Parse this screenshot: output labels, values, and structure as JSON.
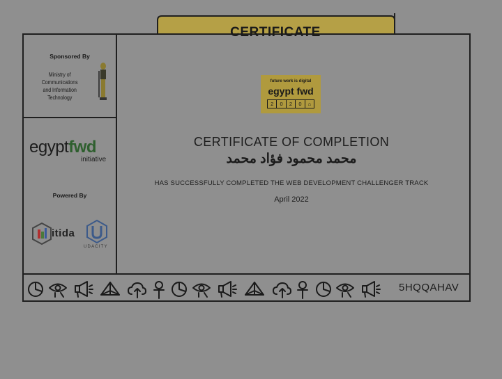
{
  "ribbon": {
    "title": "CERTIFICATE"
  },
  "sidebar": {
    "sponsored_label": "Sponsored By",
    "ministry_line1": "Ministry of Communications",
    "ministry_line2": "and Information Technology",
    "egypt_text": "egypt",
    "fwd_text": "fwd",
    "initiative_text": "initiative",
    "powered_label": "Powered By",
    "itida_text": "itida",
    "udacity_text": "UDACITY"
  },
  "badge": {
    "tagline": "future work is digital",
    "name": "egypt fwd",
    "year_digits": [
      "2",
      "0",
      "2",
      "0"
    ]
  },
  "main": {
    "heading": "CERTIFICATE OF COMPLETION",
    "recipient": "محمد محمود فؤاد محمد",
    "completed_text": "HAS SUCCESSFULLY COMPLETED THE WEB DEVELOPMENT CHALLENGER TRACK",
    "date": "April 2022"
  },
  "footer": {
    "certificate_code": "5HQQAHAV",
    "symbol_icons": [
      "pie-icon",
      "eye-icon",
      "megaphone-icon",
      "pyramid-icon",
      "cloud-upload-icon",
      "ankh-icon",
      "pie-icon",
      "eye-icon",
      "megaphone-icon",
      "pyramid-icon",
      "cloud-upload-icon",
      "ankh-icon",
      "pie-icon",
      "eye-icon",
      "megaphone-icon"
    ]
  },
  "colors": {
    "background": "#8f8f8f",
    "ribbon_gold": "#b5a046",
    "badge_gold": "#b09a3e",
    "ink": "#1a1a1a",
    "fwd_green": "#2e5f2e"
  }
}
